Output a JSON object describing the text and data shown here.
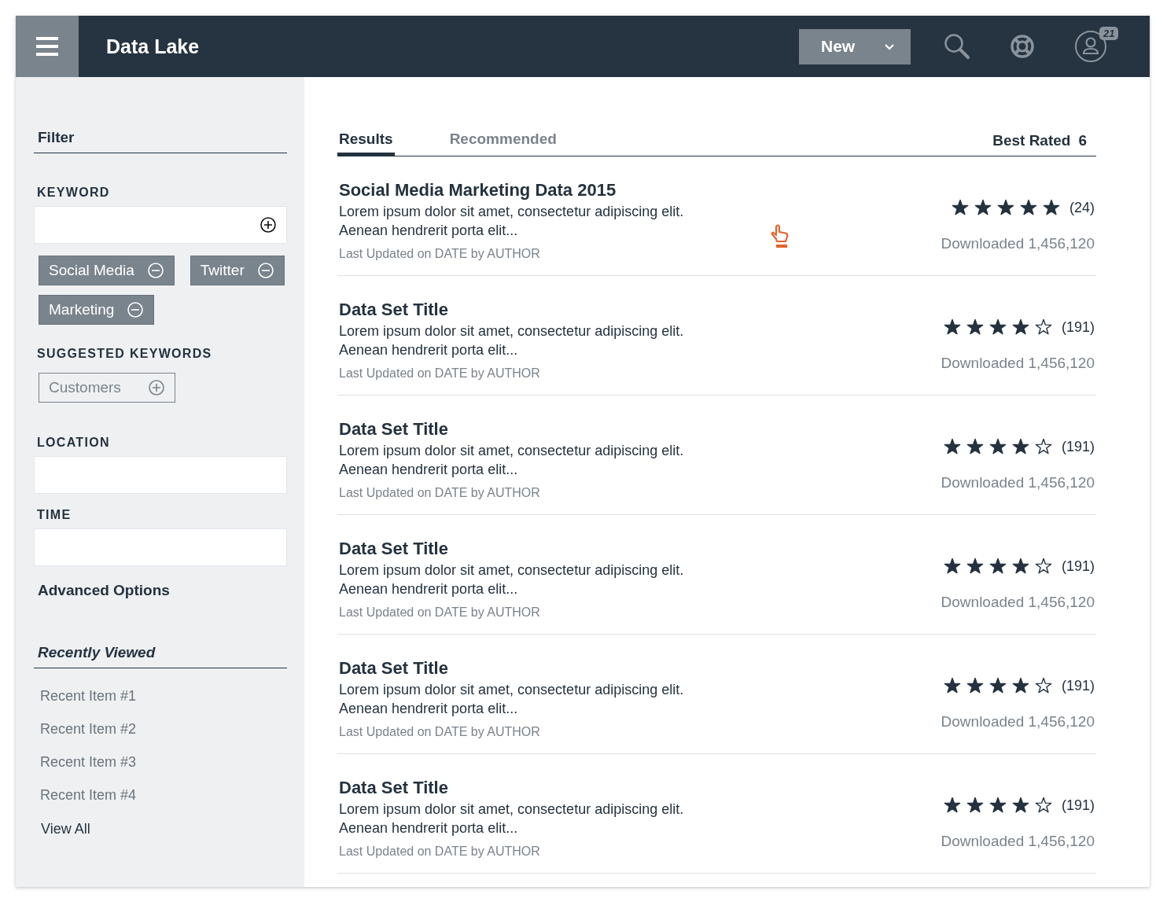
{
  "header": {
    "title": "Data Lake",
    "new_button": "New",
    "notification_count": "21"
  },
  "sidebar": {
    "filter_title": "Filter",
    "keyword_label": "KEYWORD",
    "keyword_tags": [
      {
        "label": "Social Media"
      },
      {
        "label": "Twitter"
      },
      {
        "label": "Marketing"
      }
    ],
    "suggested_label": "SUGGESTED KEYWORDS",
    "suggested_tags": [
      {
        "label": "Customers"
      }
    ],
    "location_label": "LOCATION",
    "time_label": "TIME",
    "advanced_options": "Advanced Options",
    "recent_title": "Recently Viewed",
    "recent_items": [
      "Recent Item #1",
      "Recent Item #2",
      "Recent Item #3",
      "Recent Item #4"
    ],
    "view_all": "View All"
  },
  "tabs": [
    {
      "label": "Results",
      "selected": true
    },
    {
      "label": "Recommended",
      "selected": false
    }
  ],
  "sort": {
    "label": "Best Rated",
    "count": "6"
  },
  "results": [
    {
      "title": "Social Media Marketing Data 2015",
      "description": "Lorem ipsum dolor sit amet, consectetur adipiscing elit.\nAenean hendrerit porta elit...",
      "meta": "Last Updated on DATE by AUTHOR",
      "stars": 5,
      "reviews": "(24)",
      "downloads": "Downloaded 1,456,120"
    },
    {
      "title": "Data Set Title",
      "description": "Lorem ipsum dolor sit amet, consectetur adipiscing elit.\nAenean hendrerit porta elit...",
      "meta": "Last Updated on DATE by AUTHOR",
      "stars": 4,
      "reviews": "(191)",
      "downloads": "Downloaded 1,456,120"
    },
    {
      "title": "Data Set Title",
      "description": "Lorem ipsum dolor sit amet, consectetur adipiscing elit.\nAenean hendrerit porta elit...",
      "meta": "Last Updated on DATE by AUTHOR",
      "stars": 4,
      "reviews": "(191)",
      "downloads": "Downloaded 1,456,120"
    },
    {
      "title": "Data Set Title",
      "description": "Lorem ipsum dolor sit amet, consectetur adipiscing elit.\nAenean hendrerit porta elit...",
      "meta": "Last Updated on DATE by AUTHOR",
      "stars": 4,
      "reviews": "(191)",
      "downloads": "Downloaded 1,456,120"
    },
    {
      "title": "Data Set Title",
      "description": "Lorem ipsum dolor sit amet, consectetur adipiscing elit.\nAenean hendrerit porta elit...",
      "meta": "Last Updated on DATE by AUTHOR",
      "stars": 4,
      "reviews": "(191)",
      "downloads": "Downloaded 1,456,120"
    },
    {
      "title": "Data Set Title",
      "description": "Lorem ipsum dolor sit amet, consectetur adipiscing elit.\nAenean hendrerit porta elit...",
      "meta": "Last Updated on DATE by AUTHOR",
      "stars": 4,
      "reviews": "(191)",
      "downloads": "Downloaded 1,456,120"
    }
  ]
}
